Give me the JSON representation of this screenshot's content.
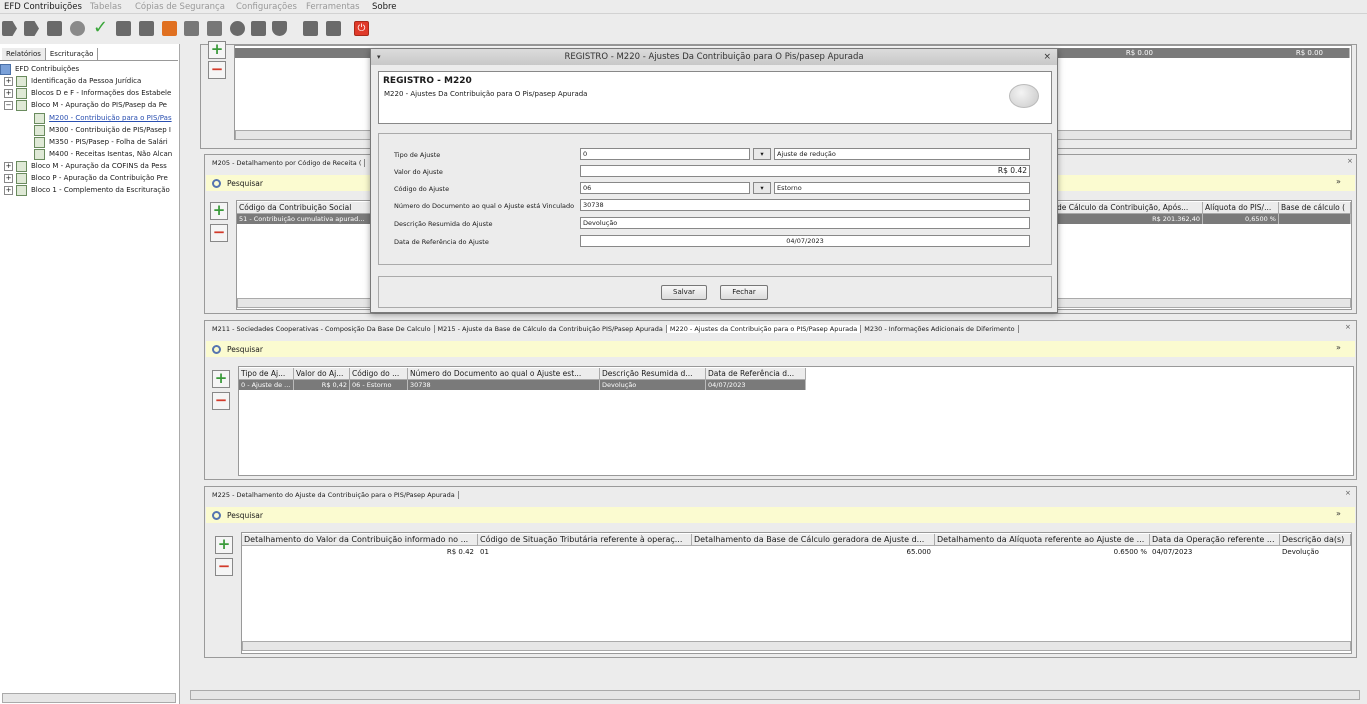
{
  "menu": [
    "EFD Contribuições",
    "Tabelas",
    "Cópias de Segurança",
    "Configurações",
    "Ferramentas",
    "Sobre"
  ],
  "left_tabs": [
    "Relatórios",
    "Escrituração"
  ],
  "tree": [
    {
      "label": "EFD Contribuições"
    },
    {
      "label": "Identificação da Pessoa Jurídica"
    },
    {
      "label": "Blocos D e F - Informações dos Estabele"
    },
    {
      "label": "Bloco M - Apuração do PIS/Pasep da Pe"
    },
    {
      "label": "M200 - Contribuição para o PIS/Pas"
    },
    {
      "label": "M300 - Contribuição de PIS/Pasep I"
    },
    {
      "label": "M350 - PIS/Pasep - Folha de Salári"
    },
    {
      "label": "M400 - Receitas Isentas, Não Alcan"
    },
    {
      "label": "Bloco M - Apuração da COFINS da Pess"
    },
    {
      "label": "Bloco P - Apuração da Contribuição Pre"
    },
    {
      "label": "Bloco 1 - Complemento da Escrituração"
    }
  ],
  "top_panel": {
    "val1": "R$ 0.00",
    "val2": "R$ 0.00"
  },
  "m205": {
    "tab": "M205 - Detalhamento por Código de Receita (",
    "search": "Pesquisar",
    "headers": [
      "Código da Contribuição Social",
      "de Cálculo da Contribuição, Após...",
      "Alíquota do PIS/...",
      "Base de cálculo ("
    ],
    "row": [
      "51 - Contribuição cumulativa apurad...",
      "R$ 201.362,40",
      "0,6500 %",
      ""
    ]
  },
  "dialog": {
    "title": "REGISTRO - M220 - Ajustes Da Contribuição para O Pis/pasep Apurada",
    "head_title": "REGISTRO - M220",
    "head_sub": "M220 - Ajustes Da Contribuição para O Pis/pasep Apurada",
    "fields": [
      {
        "label": "Tipo de Ajuste",
        "value": "0",
        "extra": "Ajuste de redução"
      },
      {
        "label": "Valor do Ajuste",
        "value": "R$ 0.42"
      },
      {
        "label": "Código do Ajuste",
        "value": "06",
        "extra": "Estorno"
      },
      {
        "label": "Número do Documento ao qual o Ajuste está Vinculado",
        "value": "30738"
      },
      {
        "label": "Descrição Resumida do Ajuste",
        "value": "Devolução"
      },
      {
        "label": "Data de Referência do Ajuste",
        "value": "04/07/2023"
      }
    ],
    "save": "Salvar",
    "close": "Fechar"
  },
  "mid_tabs": [
    "M211 - Sociedades Cooperativas - Composição Da Base De Calculo",
    "M215 - Ajuste da Base de Cálculo da Contribuição PIS/Pasep Apurada",
    "M220 - Ajustes da Contribuição para o PIS/Pasep Apurada",
    "M230 - Informações Adicionais de Diferimento"
  ],
  "m220": {
    "search": "Pesquisar",
    "headers": [
      "Tipo de Aj...",
      "Valor do Aj...",
      "Código do ...",
      "Número do Documento ao qual o Ajuste est...",
      "Descrição Resumida d...",
      "Data de Referência d..."
    ],
    "row": [
      "0 - Ajuste de ...",
      "R$ 0,42",
      "06 - Estorno",
      "30738",
      "Devolução",
      "04/07/2023"
    ]
  },
  "m225": {
    "tab": "M225 - Detalhamento do Ajuste da Contribuição para o PIS/Pasep Apurada",
    "search": "Pesquisar",
    "headers": [
      "Detalhamento do Valor da Contribuição informado no ...",
      "Código de Situação Tributária referente à operaç...",
      "Detalhamento da Base de Cálculo geradora de Ajuste d...",
      "Detalhamento da Alíquota referente ao Ajuste de ...",
      "Data da Operação referente ...",
      "Descrição da(s)"
    ],
    "row": [
      "R$ 0.42",
      "01",
      "65.000",
      "0.6500 %",
      "04/07/2023",
      "Devolução"
    ]
  }
}
